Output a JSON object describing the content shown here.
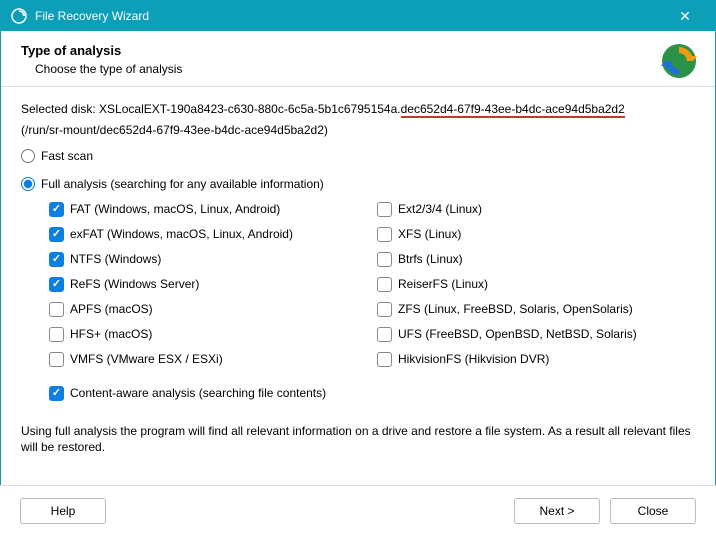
{
  "titlebar": {
    "title": "File Recovery Wizard"
  },
  "header": {
    "title": "Type of analysis",
    "subtitle": "Choose the type of analysis"
  },
  "disk": {
    "prefix": "Selected disk: XSLocalEXT-190a8423-c630-880c-6c5a-5b1c6795154a.",
    "underlined": "dec652d4-67f9-43ee-b4dc-ace94d5ba2d2",
    "path": "(/run/sr-mount/dec652d4-67f9-43ee-b4dc-ace94d5ba2d2)"
  },
  "radios": {
    "fast": {
      "label": "Fast scan",
      "selected": false
    },
    "full": {
      "label": "Full analysis (searching for any available information)",
      "selected": true
    }
  },
  "fs_left": [
    {
      "label": "FAT (Windows, macOS, Linux, Android)",
      "checked": true
    },
    {
      "label": "exFAT (Windows, macOS, Linux, Android)",
      "checked": true
    },
    {
      "label": "NTFS (Windows)",
      "checked": true
    },
    {
      "label": "ReFS (Windows Server)",
      "checked": true
    },
    {
      "label": "APFS (macOS)",
      "checked": false
    },
    {
      "label": "HFS+ (macOS)",
      "checked": false
    },
    {
      "label": "VMFS (VMware ESX / ESXi)",
      "checked": false
    }
  ],
  "fs_right": [
    {
      "label": "Ext2/3/4 (Linux)",
      "checked": false
    },
    {
      "label": "XFS (Linux)",
      "checked": false
    },
    {
      "label": "Btrfs (Linux)",
      "checked": false
    },
    {
      "label": "ReiserFS (Linux)",
      "checked": false
    },
    {
      "label": "ZFS (Linux, FreeBSD, Solaris, OpenSolaris)",
      "checked": false
    },
    {
      "label": "UFS (FreeBSD, OpenBSD, NetBSD, Solaris)",
      "checked": false
    },
    {
      "label": "HikvisionFS (Hikvision DVR)",
      "checked": false
    }
  ],
  "content_aware": {
    "label": "Content-aware analysis (searching file contents)",
    "checked": true
  },
  "note": "Using full analysis the program will find all relevant information on a drive and restore a file system. As a result all relevant files will be restored.",
  "buttons": {
    "help": "Help",
    "next": "Next >",
    "close": "Close"
  }
}
